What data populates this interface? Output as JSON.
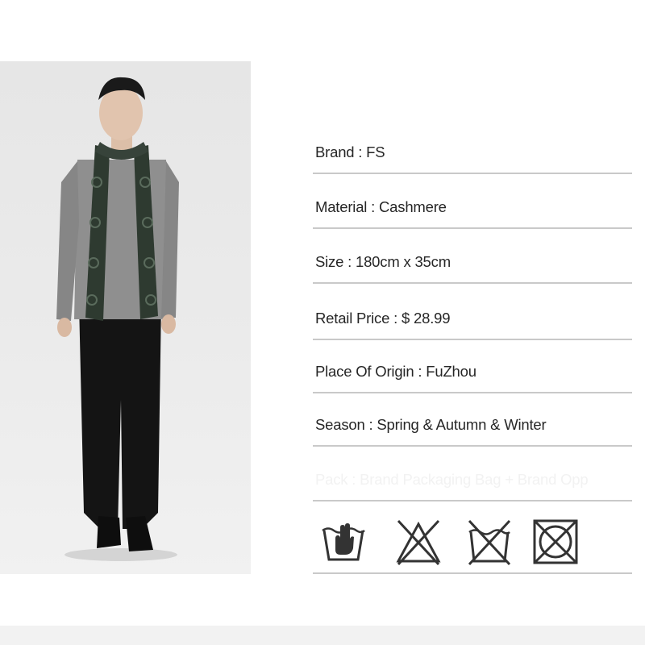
{
  "product": {
    "image_alt": "model-wearing-scarf",
    "specs": [
      {
        "text": "Brand : FS"
      },
      {
        "text": "Material :  Cashmere"
      },
      {
        "text": "Size : 180cm x 35cm"
      },
      {
        "text": "Retail Price : $ 28.99"
      },
      {
        "text": "Place Of Origin : FuZhou"
      },
      {
        "text": "Season : Spring & Autumn & Winter"
      },
      {
        "text": "Pack : Brand Packaging Bag + Brand Opp"
      }
    ],
    "care_icons": [
      "hand-wash-icon",
      "no-bleach-icon",
      "no-tumble-dry-icon",
      "no-dry-clean-icon"
    ]
  }
}
